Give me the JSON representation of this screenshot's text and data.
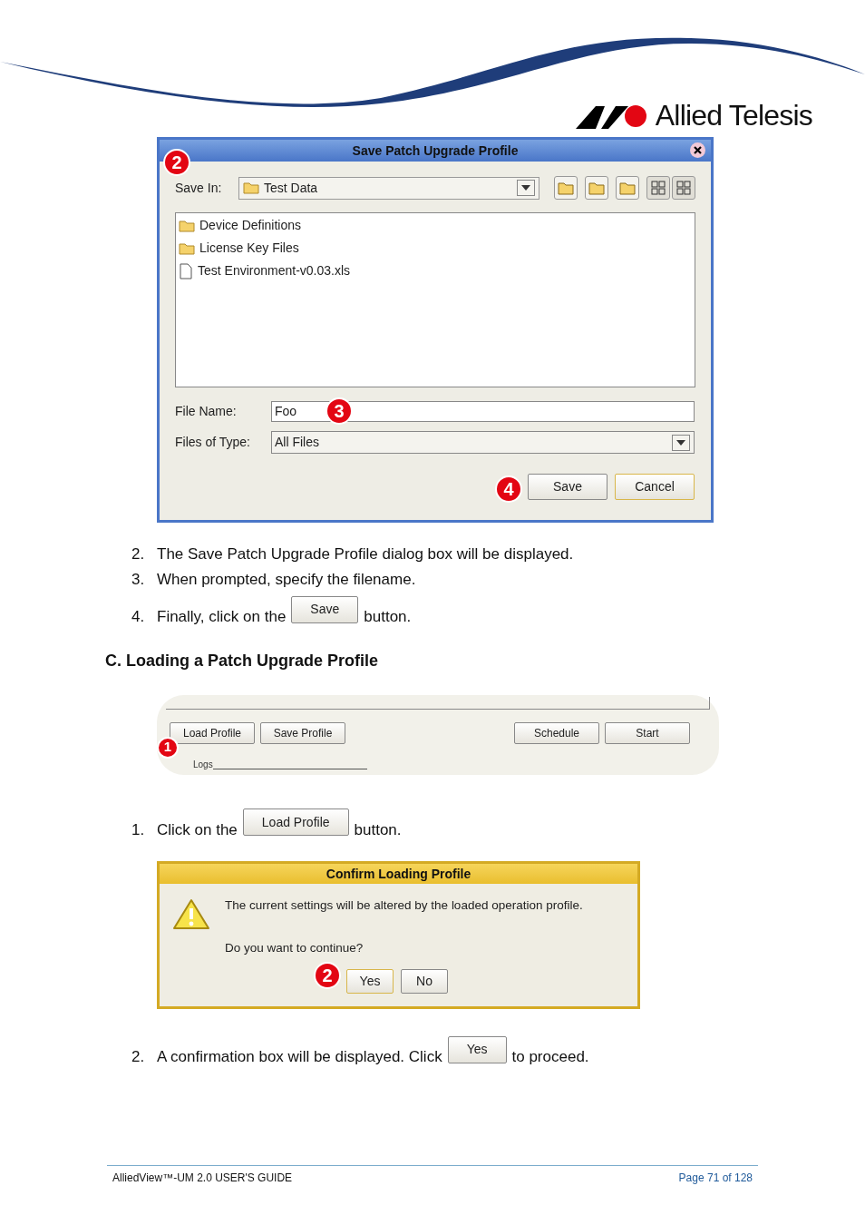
{
  "header": {
    "logo_text": "Allied Telesis"
  },
  "save_dialog": {
    "title": "Save Patch Upgrade Profile",
    "callouts": [
      "2",
      "3",
      "4"
    ],
    "save_in_label": "Save In:",
    "save_in_value": "Test Data",
    "files": [
      {
        "kind": "folder",
        "name": "Device Definitions"
      },
      {
        "kind": "folder",
        "name": "License Key Files"
      },
      {
        "kind": "file",
        "name": "Test Environment-v0.03.xls"
      }
    ],
    "file_name_label": "File Name:",
    "file_name_value": "Foo",
    "type_label": "Files of Type:",
    "type_value": "All Files",
    "buttons": [
      "Save",
      "Cancel"
    ]
  },
  "steps_save": [
    {
      "number": "2.",
      "text": "The Save Patch Upgrade Profile dialog box will be displayed."
    },
    {
      "number": "3.",
      "text": "When prompted, specify the filename."
    },
    {
      "number": "4.",
      "text": "Finally, click on the",
      "button": "Save",
      "after": "button."
    }
  ],
  "section_heading": "C. Loading a Patch Upgrade Profile",
  "toolbar": {
    "buttons": [
      "Load Profile",
      "Save Profile",
      "Schedule",
      "Start"
    ],
    "callout": "1",
    "logs_label": "Logs"
  },
  "step_load": {
    "number": "1.",
    "text": "Click on the",
    "button": "Load Profile",
    "after": "button."
  },
  "confirm_dialog": {
    "title": "Confirm Loading Profile",
    "message": "The current settings will be altered by the loaded operation profile.",
    "question": "Do you want to continue?",
    "callout": "2",
    "buttons": [
      "Yes",
      "No"
    ]
  },
  "step_confirm": {
    "number": "2.",
    "text": "A confirmation box will be displayed. Click",
    "button": "Yes",
    "after": "to proceed."
  },
  "footer": {
    "left": "AlliedView™-UM 2.0 USER'S GUIDE",
    "right": "Page 71 of 128"
  }
}
